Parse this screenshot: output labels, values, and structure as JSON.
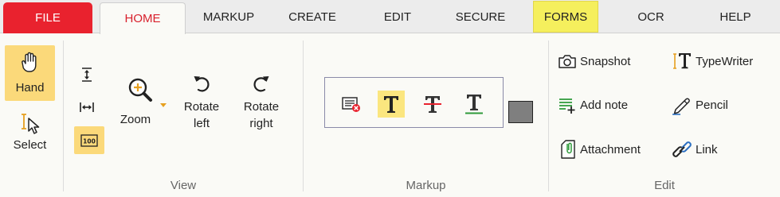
{
  "tabs": {
    "file": "FILE",
    "home": "HOME",
    "markup": "MARKUP",
    "create": "CREATE",
    "edit": "EDIT",
    "secure": "SECURE",
    "forms": "FORMS",
    "ocr": "OCR",
    "help": "HELP",
    "active": "HOME",
    "highlighted": "FORMS"
  },
  "tools": {
    "hand": "Hand",
    "select": "Select"
  },
  "view": {
    "group_label": "View",
    "zoom": "Zoom",
    "rotate_left": "Rotate left",
    "rotate_right": "Rotate right",
    "actual_size_icon_text": "100"
  },
  "markup": {
    "group_label": "Markup",
    "tools": [
      "sticky-note-delete-icon",
      "text-highlight-icon",
      "text-strikeout-icon",
      "text-underline-icon"
    ],
    "current_color": "#7f7f7f"
  },
  "edit": {
    "group_label": "Edit",
    "snapshot": "Snapshot",
    "typewriter": "TypeWriter",
    "add_note": "Add note",
    "pencil": "Pencil",
    "attachment": "Attachment",
    "link": "Link"
  },
  "colors": {
    "accent_red": "#e9222e",
    "active_tab_text": "#d8202c",
    "selection_yellow": "#fbd97a",
    "forms_highlight": "#f5ef5d",
    "add_note_green": "#2e9a3a"
  }
}
